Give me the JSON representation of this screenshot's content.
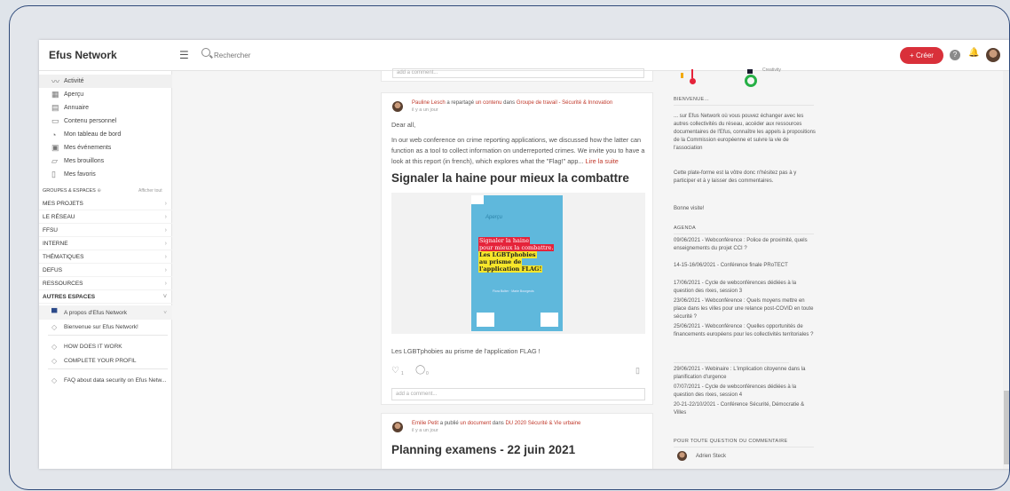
{
  "app": {
    "logo": "Efus Network",
    "search_placeholder": "Rechercher",
    "create_label": "+ Créer",
    "help_label": "?"
  },
  "sidebar": {
    "nav": [
      {
        "label": "Activité",
        "icon": "activity-icon"
      },
      {
        "label": "Aperçu",
        "icon": "grid-icon"
      },
      {
        "label": "Annuaire",
        "icon": "directory-icon"
      },
      {
        "label": "Contenu personnel",
        "icon": "folder-icon"
      },
      {
        "label": "Mon tableau de bord",
        "icon": "dashboard-icon"
      },
      {
        "label": "Mes événements",
        "icon": "calendar-icon"
      },
      {
        "label": "Mes brouillons",
        "icon": "draft-icon"
      },
      {
        "label": "Mes favoris",
        "icon": "bookmark-icon"
      }
    ],
    "groups_header": "GROUPES & ESPACES",
    "show_all": "Afficher tout",
    "sections": [
      "MES PROJETS",
      "LE RÉSEAU",
      "FFSU",
      "INTERNE",
      "THÉMATIQUES",
      "DEFUS",
      "RESSOURCES",
      "AUTRES ESPACES"
    ],
    "spaces": [
      "A propos d'Efus Network",
      "Bienvenue sur Efus Network!",
      "HOW DOES IT WORK",
      "COMPLETE YOUR PROFIL",
      "FAQ about data security on Efus Netw..."
    ]
  },
  "feed": {
    "top_comment_placeholder": "add a comment...",
    "post1": {
      "author": "Pauline Lesch",
      "shared_text": "a repartagé",
      "content_link": "un contenu",
      "in_text": "dans",
      "group": "Groupe de travail - Sécurité & Innovation",
      "time": "il y a un jour",
      "greeting": "Dear all,",
      "body": "In our web conference on crime reporting applications, we discussed how the latter can function as a tool to collect information on underreported crimes. We invite you to have a look at this report (in french), which explores what the \"Flag!\" app...",
      "read_more": "Lire la suite",
      "title": "Signaler la haine pour mieux la combattre",
      "cover_top": "Aperçu",
      "cover_lines": [
        "Signaler la haine",
        "pour mieux la combattre.",
        "Les LGBTphobies",
        "au prisme de",
        "l'application FLAG!"
      ],
      "cover_author": "Flora Bolter · Marie Bourgeois",
      "caption": "Les LGBTphobies au prisme de l'application FLAG !",
      "likes": "1",
      "comments": "0",
      "comment_placeholder": "add a comment..."
    },
    "post2": {
      "author": "Emilie Petit",
      "published_text": "a publié",
      "content_link": "un document",
      "in_text": "dans",
      "group": "DU 2020 Sécurité & Vie urbaine",
      "time": "il y a un jour",
      "title": "Planning examens - 22 juin 2021"
    }
  },
  "right": {
    "top_label": "Creativity",
    "welcome_header": "BIENVENUE...",
    "welcome_text": "... sur Efus Network où vous pouvez échanger avec les autres collectivités du réseau, accéder aux ressources documentaires de l'Efus, connaître les appels à propositions de la Commission européenne et suivre la vie de l'association",
    "welcome_text2": "Cette plate-forme est la vôtre donc n'hésitez pas à y participer et à y laisser des commentaires.",
    "welcome_text3": "Bonne visite!",
    "agenda_header": "AGENDA",
    "agenda": [
      "09/06/2021 - Webconférence : Police de proximité, quels enseignements du projet CCI ?",
      "14-15-16/06/2021 - Conférence finale PRoTECT",
      "17/06/2021 - Cycle de webconférences dédiées à la question des rixes, session 3",
      "23/06/2021 - Webconférence : Quels moyens mettre en place dans les villes pour une relance post-COVID en toute sécurité ?",
      "25/06/2021 - Webconférence : Quelles opportunités de financements européens pour les collectivités territoriales ?"
    ],
    "agenda2": [
      "29/06/2021 - Webinaire : L'implication citoyenne dans la planification d'urgence",
      "07/07/2021 - Cycle de webconférences dédiées à la question des rixes, session 4",
      "20-21-22/10/2021 - Conférence Sécurité, Démocratie & Villes"
    ],
    "contact_header": "POUR TOUTE QUESTION OU COMMENTAIRE",
    "contact_name": "Adrien Steck"
  },
  "colors": {
    "accent": "#d9303a",
    "link": "#c0392b",
    "cover": "#5fb8dc"
  }
}
